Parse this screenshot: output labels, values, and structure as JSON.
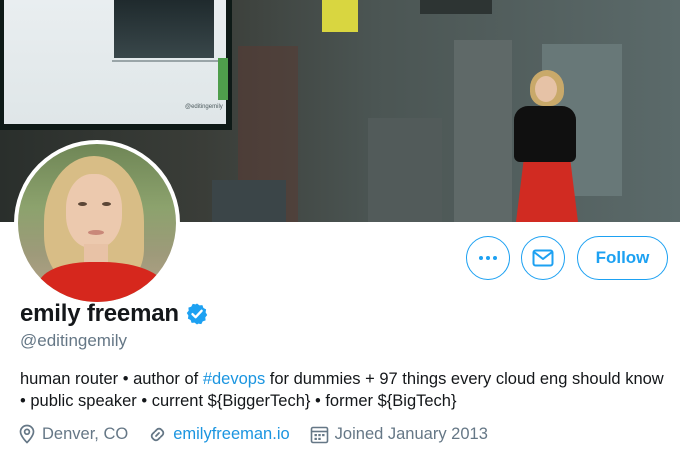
{
  "profile": {
    "display_name": "emily freeman",
    "handle": "@editingemily",
    "verified_icon": "verified-badge-icon",
    "bio": {
      "part1": "human router • author of ",
      "hashtag": "#devops",
      "part2": " for dummies + 97 things every cloud eng should know • public speaker • current ${BiggerTech} • former ${BigTech}"
    },
    "location": "Denver, CO",
    "website": "emilyfreeman.io",
    "joined": "Joined January 2013"
  },
  "banner": {
    "screen_caption": "@editingemily"
  },
  "actions": {
    "more_icon": "more-dots-icon",
    "message_icon": "envelope-icon",
    "follow_label": "Follow"
  },
  "colors": {
    "accent": "#1da1f2",
    "link": "#1b95e0",
    "secondary_text": "#657786",
    "primary_text": "#14171a"
  }
}
